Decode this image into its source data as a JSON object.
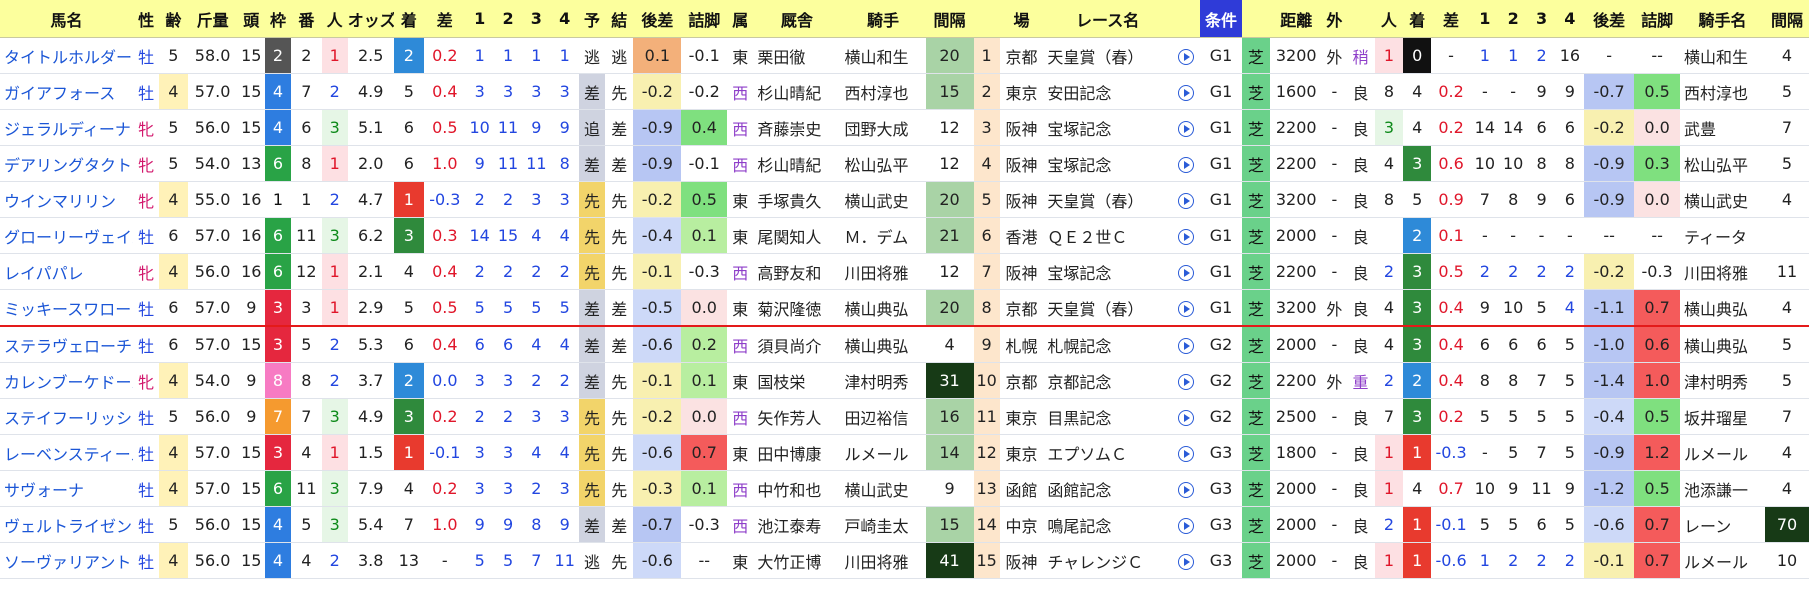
{
  "headers": [
    "馬名",
    "性",
    "齢",
    "斤量",
    "頭",
    "枠",
    "番",
    "人",
    "オッズ",
    "着",
    "差",
    "1",
    "2",
    "3",
    "4",
    "予",
    "結",
    "後差",
    "詰脚",
    "属",
    "厩舎",
    "騎手",
    "間隔",
    "",
    "場",
    "レース名",
    "",
    "条件",
    "",
    "距離",
    "外",
    "",
    "人",
    "着",
    "差",
    "1",
    "2",
    "3",
    "4",
    "後差",
    "詰脚",
    "騎手名",
    "間隔"
  ],
  "rows": [
    {
      "name": "タイトルホルダー",
      "sex": "牡",
      "age": "5",
      "weight": "58.0",
      "heads": "15",
      "waku": "2",
      "ban": "2",
      "pop": "1",
      "odds": "2.5",
      "rank": "2",
      "diff": "0.2",
      "c1": "1",
      "c2": "1",
      "c3": "1",
      "c4": "1",
      "yo": "逃",
      "ketsu": "逃",
      "kosa": "0.1",
      "tsume": "-0.1",
      "zoku": "東",
      "stable": "栗田徹",
      "jockey": "横山和生",
      "gap": "20",
      "no": "1",
      "place": "京都",
      "race": "天皇賞（春）",
      "cls": "G1",
      "surf": "芝",
      "dist": "3200",
      "out": "外",
      "baba": "稍",
      "p_pop": "1",
      "p_rank": "0",
      "p_diff": "-",
      "p1": "1",
      "p2": "1",
      "p3": "2",
      "p4": "16",
      "p_kosa": "-",
      "p_tsume": "--",
      "p_jockey": "横山和生",
      "p_gap": "4"
    },
    {
      "name": "ガイアフォース",
      "sex": "牡",
      "age": "4",
      "weight": "57.0",
      "heads": "15",
      "waku": "4",
      "ban": "7",
      "pop": "2",
      "odds": "4.9",
      "rank": "5",
      "diff": "0.4",
      "c1": "3",
      "c2": "3",
      "c3": "3",
      "c4": "3",
      "yo": "差",
      "ketsu": "先",
      "kosa": "-0.2",
      "tsume": "-0.2",
      "zoku": "西",
      "stable": "杉山晴紀",
      "jockey": "西村淳也",
      "gap": "15",
      "no": "2",
      "place": "東京",
      "race": "安田記念",
      "cls": "G1",
      "surf": "芝",
      "dist": "1600",
      "out": "-",
      "baba": "良",
      "p_pop": "8",
      "p_rank": "4",
      "p_diff": "0.2",
      "p1": "-",
      "p2": "-",
      "p3": "9",
      "p4": "9",
      "p_kosa": "-0.7",
      "p_tsume": "0.5",
      "p_jockey": "西村淳也",
      "p_gap": "5"
    },
    {
      "name": "ジェラルディーナ",
      "sex": "牝",
      "age": "5",
      "weight": "56.0",
      "heads": "15",
      "waku": "4",
      "ban": "6",
      "pop": "3",
      "odds": "5.1",
      "rank": "6",
      "diff": "0.5",
      "c1": "10",
      "c2": "11",
      "c3": "9",
      "c4": "9",
      "yo": "追",
      "ketsu": "差",
      "kosa": "-0.9",
      "tsume": "0.4",
      "zoku": "西",
      "stable": "斉藤崇史",
      "jockey": "団野大成",
      "gap": "12",
      "no": "3",
      "place": "阪神",
      "race": "宝塚記念",
      "cls": "G1",
      "surf": "芝",
      "dist": "2200",
      "out": "-",
      "baba": "良",
      "p_pop": "3",
      "p_rank": "4",
      "p_diff": "0.2",
      "p1": "14",
      "p2": "14",
      "p3": "6",
      "p4": "6",
      "p_kosa": "-0.2",
      "p_tsume": "0.0",
      "p_jockey": "武豊",
      "p_gap": "7"
    },
    {
      "name": "デアリングタクト",
      "sex": "牝",
      "age": "5",
      "weight": "54.0",
      "heads": "13",
      "waku": "6",
      "ban": "8",
      "pop": "1",
      "odds": "2.0",
      "rank": "6",
      "diff": "1.0",
      "c1": "9",
      "c2": "11",
      "c3": "11",
      "c4": "8",
      "yo": "差",
      "ketsu": "差",
      "kosa": "-0.9",
      "tsume": "-0.1",
      "zoku": "西",
      "stable": "杉山晴紀",
      "jockey": "松山弘平",
      "gap": "12",
      "no": "4",
      "place": "阪神",
      "race": "宝塚記念",
      "cls": "G1",
      "surf": "芝",
      "dist": "2200",
      "out": "-",
      "baba": "良",
      "p_pop": "4",
      "p_rank": "3",
      "p_diff": "0.6",
      "p1": "10",
      "p2": "10",
      "p3": "8",
      "p4": "8",
      "p_kosa": "-0.9",
      "p_tsume": "0.3",
      "p_jockey": "松山弘平",
      "p_gap": "5"
    },
    {
      "name": "ウインマリリン",
      "sex": "牝",
      "age": "4",
      "weight": "55.0",
      "heads": "16",
      "waku": "1",
      "ban": "1",
      "pop": "2",
      "odds": "4.7",
      "rank": "1",
      "diff": "-0.3",
      "c1": "2",
      "c2": "2",
      "c3": "3",
      "c4": "3",
      "yo": "先",
      "ketsu": "先",
      "kosa": "-0.2",
      "tsume": "0.5",
      "zoku": "東",
      "stable": "手塚貴久",
      "jockey": "横山武史",
      "gap": "20",
      "no": "5",
      "place": "阪神",
      "race": "天皇賞（春）",
      "cls": "G1",
      "surf": "芝",
      "dist": "3200",
      "out": "-",
      "baba": "良",
      "p_pop": "8",
      "p_rank": "5",
      "p_diff": "0.9",
      "p1": "7",
      "p2": "8",
      "p3": "9",
      "p4": "6",
      "p_kosa": "-0.9",
      "p_tsume": "0.0",
      "p_jockey": "横山武史",
      "p_gap": "4"
    },
    {
      "name": "グローリーヴェイズ",
      "sex": "牡",
      "age": "6",
      "weight": "57.0",
      "heads": "16",
      "waku": "6",
      "ban": "11",
      "pop": "3",
      "odds": "6.2",
      "rank": "3",
      "diff": "0.3",
      "c1": "14",
      "c2": "15",
      "c3": "4",
      "c4": "4",
      "yo": "先",
      "ketsu": "先",
      "kosa": "-0.4",
      "tsume": "0.1",
      "zoku": "東",
      "stable": "尾関知人",
      "jockey": "Ｍ．デム",
      "gap": "21",
      "no": "6",
      "place": "香港",
      "race": "ＱＥ２世Ｃ",
      "cls": "G1",
      "surf": "芝",
      "dist": "2000",
      "out": "-",
      "baba": "良",
      "p_pop": "",
      "p_rank": "2",
      "p_diff": "0.1",
      "p1": "-",
      "p2": "-",
      "p3": "-",
      "p4": "-",
      "p_kosa": "--",
      "p_tsume": "--",
      "p_jockey": "ティータ",
      "p_gap": ""
    },
    {
      "name": "レイパパレ",
      "sex": "牝",
      "age": "4",
      "weight": "56.0",
      "heads": "16",
      "waku": "6",
      "ban": "12",
      "pop": "1",
      "odds": "2.1",
      "rank": "4",
      "diff": "0.4",
      "c1": "2",
      "c2": "2",
      "c3": "2",
      "c4": "2",
      "yo": "先",
      "ketsu": "先",
      "kosa": "-0.1",
      "tsume": "-0.3",
      "zoku": "西",
      "stable": "高野友和",
      "jockey": "川田将雅",
      "gap": "12",
      "no": "7",
      "place": "阪神",
      "race": "宝塚記念",
      "cls": "G1",
      "surf": "芝",
      "dist": "2200",
      "out": "-",
      "baba": "良",
      "p_pop": "2",
      "p_rank": "3",
      "p_diff": "0.5",
      "p1": "2",
      "p2": "2",
      "p3": "2",
      "p4": "2",
      "p_kosa": "-0.2",
      "p_tsume": "-0.3",
      "p_jockey": "川田将雅",
      "p_gap": "11"
    },
    {
      "name": "ミッキースワロー",
      "sex": "牡",
      "age": "6",
      "weight": "57.0",
      "heads": "9",
      "waku": "3",
      "ban": "3",
      "pop": "1",
      "odds": "2.9",
      "rank": "5",
      "diff": "0.5",
      "c1": "5",
      "c2": "5",
      "c3": "5",
      "c4": "5",
      "yo": "差",
      "ketsu": "差",
      "kosa": "-0.5",
      "tsume": "0.0",
      "zoku": "東",
      "stable": "菊沢隆徳",
      "jockey": "横山典弘",
      "gap": "20",
      "no": "8",
      "place": "京都",
      "race": "天皇賞（春）",
      "cls": "G1",
      "surf": "芝",
      "dist": "3200",
      "out": "外",
      "baba": "良",
      "p_pop": "4",
      "p_rank": "3",
      "p_diff": "0.4",
      "p1": "9",
      "p2": "10",
      "p3": "5",
      "p4": "4",
      "p_kosa": "-1.1",
      "p_tsume": "0.7",
      "p_jockey": "横山典弘",
      "p_gap": "4"
    },
    {
      "name": "ステラヴェローチェ",
      "sex": "牡",
      "age": "6",
      "weight": "57.0",
      "heads": "15",
      "waku": "3",
      "ban": "5",
      "pop": "2",
      "odds": "5.3",
      "rank": "6",
      "diff": "0.4",
      "c1": "6",
      "c2": "6",
      "c3": "4",
      "c4": "4",
      "yo": "差",
      "ketsu": "差",
      "kosa": "-0.6",
      "tsume": "0.2",
      "zoku": "西",
      "stable": "須貝尚介",
      "jockey": "横山典弘",
      "gap": "4",
      "no": "9",
      "place": "札幌",
      "race": "札幌記念",
      "cls": "G2",
      "surf": "芝",
      "dist": "2000",
      "out": "-",
      "baba": "良",
      "p_pop": "4",
      "p_rank": "3",
      "p_diff": "0.4",
      "p1": "6",
      "p2": "6",
      "p3": "6",
      "p4": "5",
      "p_kosa": "-1.0",
      "p_tsume": "0.6",
      "p_jockey": "横山典弘",
      "p_gap": "5"
    },
    {
      "name": "カレンブーケドール",
      "sex": "牝",
      "age": "4",
      "weight": "54.0",
      "heads": "9",
      "waku": "8",
      "ban": "8",
      "pop": "2",
      "odds": "3.7",
      "rank": "2",
      "diff": "0.0",
      "c1": "3",
      "c2": "3",
      "c3": "2",
      "c4": "2",
      "yo": "差",
      "ketsu": "先",
      "kosa": "-0.1",
      "tsume": "0.1",
      "zoku": "東",
      "stable": "国枝栄",
      "jockey": "津村明秀",
      "gap": "31",
      "no": "10",
      "place": "京都",
      "race": "京都記念",
      "cls": "G2",
      "surf": "芝",
      "dist": "2200",
      "out": "外",
      "baba": "重",
      "p_pop": "2",
      "p_rank": "2",
      "p_diff": "0.4",
      "p1": "8",
      "p2": "8",
      "p3": "7",
      "p4": "5",
      "p_kosa": "-1.4",
      "p_tsume": "1.0",
      "p_jockey": "津村明秀",
      "p_gap": "5"
    },
    {
      "name": "ステイフーリッシュ",
      "sex": "牡",
      "age": "5",
      "weight": "56.0",
      "heads": "9",
      "waku": "7",
      "ban": "7",
      "pop": "3",
      "odds": "4.9",
      "rank": "3",
      "diff": "0.2",
      "c1": "2",
      "c2": "2",
      "c3": "3",
      "c4": "3",
      "yo": "先",
      "ketsu": "先",
      "kosa": "-0.2",
      "tsume": "0.0",
      "zoku": "西",
      "stable": "矢作芳人",
      "jockey": "田辺裕信",
      "gap": "16",
      "no": "11",
      "place": "東京",
      "race": "目黒記念",
      "cls": "G2",
      "surf": "芝",
      "dist": "2500",
      "out": "-",
      "baba": "良",
      "p_pop": "7",
      "p_rank": "3",
      "p_diff": "0.2",
      "p1": "5",
      "p2": "5",
      "p3": "5",
      "p4": "5",
      "p_kosa": "-0.4",
      "p_tsume": "0.5",
      "p_jockey": "坂井瑠星",
      "p_gap": "7"
    },
    {
      "name": "レーベンスティール",
      "sex": "牡",
      "age": "4",
      "weight": "57.0",
      "heads": "15",
      "waku": "3",
      "ban": "4",
      "pop": "1",
      "odds": "1.5",
      "rank": "1",
      "diff": "-0.1",
      "c1": "3",
      "c2": "3",
      "c3": "4",
      "c4": "4",
      "yo": "先",
      "ketsu": "先",
      "kosa": "-0.6",
      "tsume": "0.7",
      "zoku": "東",
      "stable": "田中博康",
      "jockey": "ルメール",
      "gap": "14",
      "no": "12",
      "place": "東京",
      "race": "エプソムＣ",
      "cls": "G3",
      "surf": "芝",
      "dist": "1800",
      "out": "-",
      "baba": "良",
      "p_pop": "1",
      "p_rank": "1",
      "p_diff": "-0.3",
      "p1": "-",
      "p2": "5",
      "p3": "7",
      "p4": "5",
      "p_kosa": "-0.9",
      "p_tsume": "1.2",
      "p_jockey": "ルメール",
      "p_gap": "4"
    },
    {
      "name": "サヴォーナ",
      "sex": "牡",
      "age": "4",
      "weight": "57.0",
      "heads": "15",
      "waku": "6",
      "ban": "11",
      "pop": "3",
      "odds": "7.9",
      "rank": "4",
      "diff": "0.2",
      "c1": "3",
      "c2": "3",
      "c3": "2",
      "c4": "3",
      "yo": "先",
      "ketsu": "先",
      "kosa": "-0.3",
      "tsume": "0.1",
      "zoku": "西",
      "stable": "中竹和也",
      "jockey": "横山武史",
      "gap": "9",
      "no": "13",
      "place": "函館",
      "race": "函館記念",
      "cls": "G3",
      "surf": "芝",
      "dist": "2000",
      "out": "-",
      "baba": "良",
      "p_pop": "1",
      "p_rank": "4",
      "p_diff": "0.7",
      "p1": "10",
      "p2": "9",
      "p3": "11",
      "p4": "9",
      "p_kosa": "-1.2",
      "p_tsume": "0.5",
      "p_jockey": "池添謙一",
      "p_gap": "4"
    },
    {
      "name": "ヴェルトライゼンデ",
      "sex": "牡",
      "age": "5",
      "weight": "56.0",
      "heads": "15",
      "waku": "4",
      "ban": "5",
      "pop": "3",
      "odds": "5.4",
      "rank": "7",
      "diff": "1.0",
      "c1": "9",
      "c2": "9",
      "c3": "8",
      "c4": "9",
      "yo": "差",
      "ketsu": "差",
      "kosa": "-0.7",
      "tsume": "-0.3",
      "zoku": "西",
      "stable": "池江泰寿",
      "jockey": "戸崎圭太",
      "gap": "15",
      "no": "14",
      "place": "中京",
      "race": "鳴尾記念",
      "cls": "G3",
      "surf": "芝",
      "dist": "2000",
      "out": "-",
      "baba": "良",
      "p_pop": "2",
      "p_rank": "1",
      "p_diff": "-0.1",
      "p1": "5",
      "p2": "5",
      "p3": "6",
      "p4": "5",
      "p_kosa": "-0.6",
      "p_tsume": "0.7",
      "p_jockey": "レーン",
      "p_gap": "70"
    },
    {
      "name": "ソーヴァリアント",
      "sex": "牡",
      "age": "4",
      "weight": "56.0",
      "heads": "15",
      "waku": "4",
      "ban": "4",
      "pop": "2",
      "odds": "3.8",
      "rank": "13",
      "diff": "-",
      "c1": "5",
      "c2": "5",
      "c3": "7",
      "c4": "11",
      "yo": "逃",
      "ketsu": "先",
      "kosa": "-0.6",
      "tsume": "--",
      "zoku": "東",
      "stable": "大竹正博",
      "jockey": "川田将雅",
      "gap": "41",
      "no": "15",
      "place": "阪神",
      "race": "チャレンジＣ",
      "cls": "G3",
      "surf": "芝",
      "dist": "2000",
      "out": "-",
      "baba": "良",
      "p_pop": "1",
      "p_rank": "1",
      "p_diff": "-0.6",
      "p1": "1",
      "p2": "2",
      "p3": "2",
      "p4": "2",
      "p_kosa": "-0.1",
      "p_tsume": "0.7",
      "p_jockey": "ルメール",
      "p_gap": "10"
    }
  ]
}
